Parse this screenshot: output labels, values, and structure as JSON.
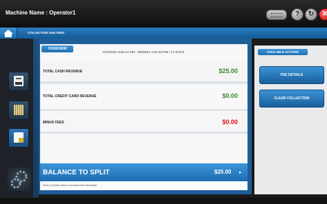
{
  "header": {
    "machine_name": "Machine Name : Operator1"
  },
  "breadcrumb": {
    "label": "COLLECTION AND FEES"
  },
  "overview": {
    "tab_label": "OVERVIEW",
    "date_range": "7/22/2011 3:52:14 PM - 8/8/2011 1:31:53 PM  |  17 DAYS",
    "rows": [
      {
        "label": "TOTAL CASH REVENUE",
        "value": "$25.00"
      },
      {
        "label": "TOTAL CREDIT CARD REVENUE",
        "value": "$0.00"
      },
      {
        "label": "MINUS FEES",
        "value": "$0.00"
      }
    ],
    "balance_label": "BALANCE TO SPLIT",
    "balance_value": "$25.00",
    "hint": "Press (+) button above to access more information"
  },
  "actions": {
    "header": "AVAILABLE ACTIONS",
    "fee_details": "FEE DETAILS",
    "clear_collection": "CLEAR COLLECTION"
  },
  "colors": {
    "accent": "#1e6fb2",
    "positive": "#3a8a2a",
    "negative": "#e01010"
  },
  "icons": [
    "home-icon",
    "keyboard-icon",
    "help-icon",
    "refresh-icon",
    "close-icon",
    "printer-icon",
    "money-icon",
    "document-icon",
    "gears-icon"
  ]
}
